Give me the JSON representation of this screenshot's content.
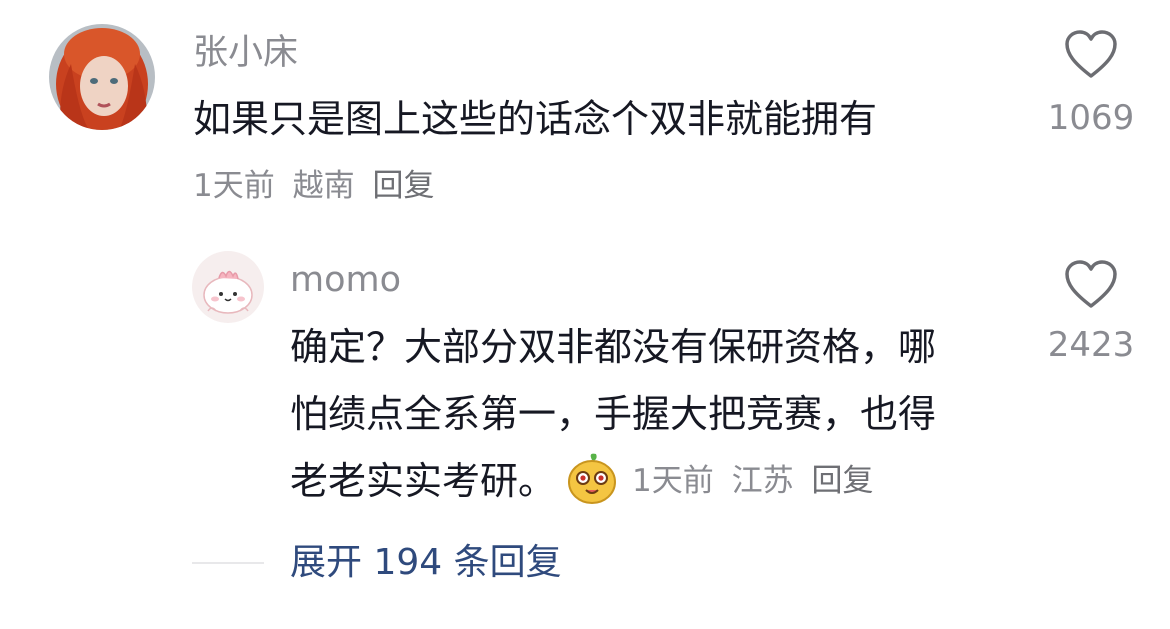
{
  "comment": {
    "username": "张小床",
    "text": "如果只是图上这些的话念个双非就能拥有",
    "time": "1天前",
    "location": "越南",
    "reply_label": "回复",
    "likes": "1069",
    "avatar_icon": "profile-photo-red-hair"
  },
  "reply": {
    "username": "momo",
    "text_lines": [
      "确定？大部分双非都没有保研资格，哪",
      "怕绩点全系第一，手握大把竞赛，也得",
      "老老实实考研。"
    ],
    "sticker_icon": "cute-emoji-sticker",
    "time": "1天前",
    "location": "江苏",
    "reply_label": "回复",
    "likes": "2423",
    "avatar_icon": "pink-cartoon-avatar"
  },
  "expand": {
    "label": "展开 194 条回复"
  },
  "colors": {
    "primary_text": "#161823",
    "secondary_text": "#8a8b91",
    "link": "#2f4a7d"
  }
}
